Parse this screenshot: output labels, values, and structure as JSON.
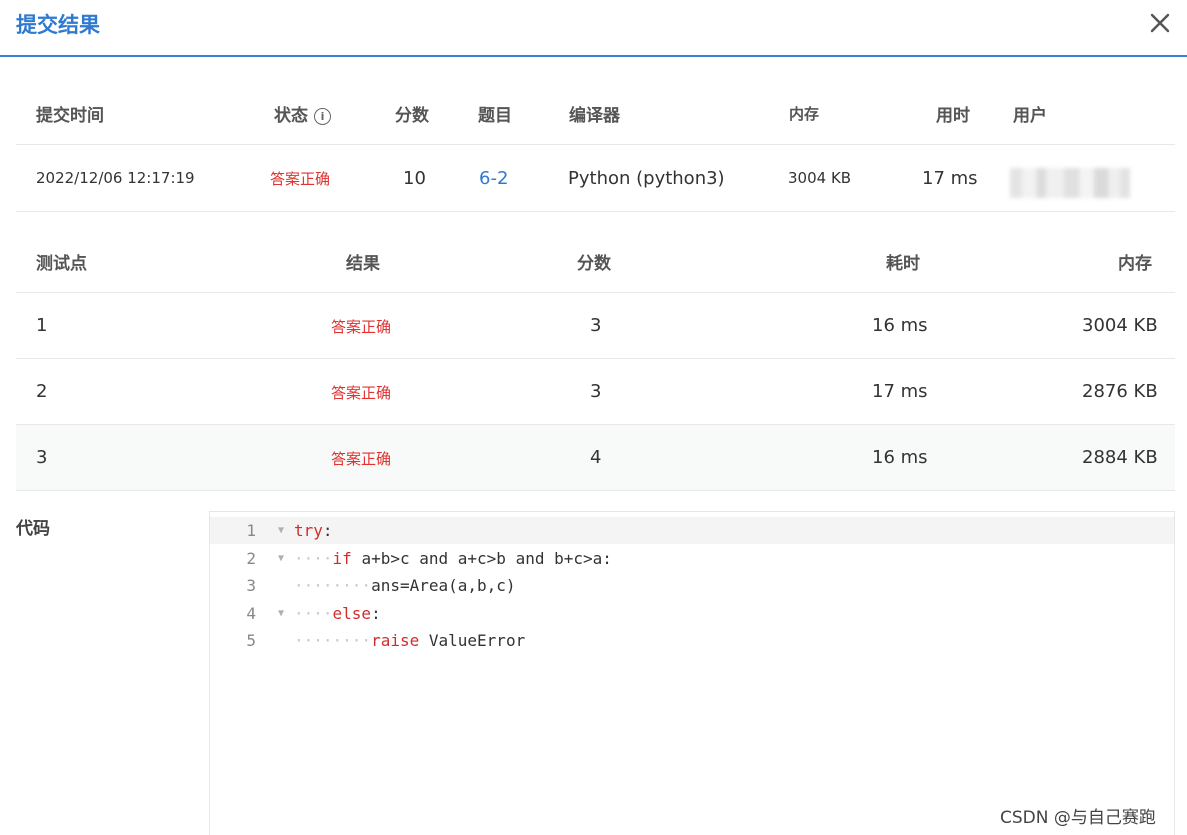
{
  "dialog": {
    "title": "提交结果"
  },
  "submission": {
    "headers": {
      "time": "提交时间",
      "status": "状态",
      "score": "分数",
      "problem": "题目",
      "compiler": "编译器",
      "memory": "内存",
      "duration": "用时",
      "user": "用户"
    },
    "status_info_icon": "info-circle-icon",
    "row": {
      "time": "2022/12/06 12:17:19",
      "status": "答案正确",
      "score": "10",
      "problem": "6-2",
      "compiler": "Python (python3)",
      "memory": "3004 KB",
      "duration": "17 ms"
    }
  },
  "testcases": {
    "headers": {
      "case": "测试点",
      "result": "结果",
      "score": "分数",
      "duration": "耗时",
      "memory": "内存"
    },
    "rows": [
      {
        "case": "1",
        "result": "答案正确",
        "score": "3",
        "duration": "16 ms",
        "memory": "3004 KB"
      },
      {
        "case": "2",
        "result": "答案正确",
        "score": "3",
        "duration": "17 ms",
        "memory": "2876 KB"
      },
      {
        "case": "3",
        "result": "答案正确",
        "score": "4",
        "duration": "16 ms",
        "memory": "2884 KB"
      }
    ]
  },
  "code": {
    "label": "代码",
    "lines": [
      {
        "no": "1",
        "indent": "",
        "keyword": "try",
        "rest": ":"
      },
      {
        "no": "2",
        "indent": "····",
        "keyword": "if",
        "rest": "a+b>c and a+c>b and b+c>a:"
      },
      {
        "no": "3",
        "indent": "········",
        "keyword": "",
        "rest": "ans=Area(a,b,c)"
      },
      {
        "no": "4",
        "indent": "····",
        "keyword": "else",
        "rest": ":"
      },
      {
        "no": "5",
        "indent": "········",
        "keyword": "raise",
        "rest": "ValueError"
      }
    ]
  },
  "watermark": "CSDN @与自己赛跑",
  "colors": {
    "accent": "#2f7ad0",
    "success_text": "#e0322f"
  }
}
